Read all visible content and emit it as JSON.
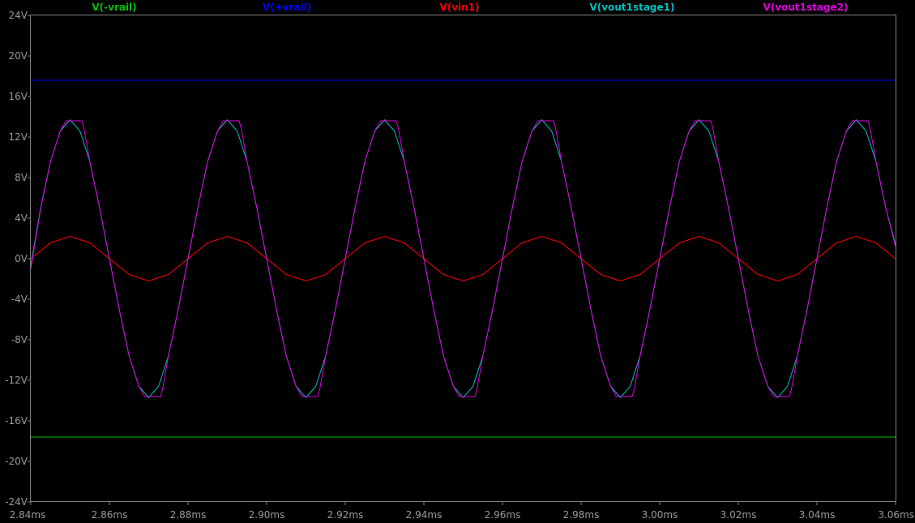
{
  "chart_data": {
    "type": "line",
    "title": "",
    "xlabel": "",
    "ylabel": "",
    "xlim": [
      2.84,
      3.06
    ],
    "ylim": [
      -24,
      24
    ],
    "grid": false,
    "legend_position": "top",
    "x_ticks": [
      2.84,
      2.86,
      2.88,
      2.9,
      2.92,
      2.94,
      2.96,
      2.98,
      3.0,
      3.02,
      3.04,
      3.06
    ],
    "x_tick_labels": [
      "2.84ms",
      "2.86ms",
      "2.88ms",
      "2.90ms",
      "2.92ms",
      "2.94ms",
      "2.96ms",
      "2.98ms",
      "3.00ms",
      "3.02ms",
      "3.04ms",
      "3.06ms"
    ],
    "y_ticks": [
      24,
      20,
      16,
      12,
      8,
      4,
      0,
      -4,
      -8,
      -12,
      -16,
      -20,
      -24
    ],
    "y_tick_labels": [
      "24V",
      "20V",
      "16V",
      "12V",
      "8V",
      "4V",
      "0V",
      "-4V",
      "-8V",
      "-12V",
      "-16V",
      "-20V",
      "-24V"
    ],
    "series": [
      {
        "name": "V(-vrail)",
        "color": "#00c000",
        "x": [
          2.84,
          3.06
        ],
        "values": [
          -17.6,
          -17.6
        ]
      },
      {
        "name": "V(+vrail)",
        "color": "#0000ff",
        "x": [
          2.84,
          3.06
        ],
        "values": [
          17.6,
          17.6
        ]
      },
      {
        "name": "V(vin1)",
        "color": "#ff0000",
        "x": [
          2.84,
          2.845,
          2.85,
          2.855,
          2.86,
          2.865,
          2.87,
          2.875,
          2.88,
          2.885,
          2.89,
          2.895,
          2.9,
          2.905,
          2.91,
          2.915,
          2.92,
          2.925,
          2.93,
          2.935,
          2.94,
          2.945,
          2.95,
          2.955,
          2.96,
          2.965,
          2.97,
          2.975,
          2.98,
          2.985,
          2.99,
          2.995,
          3.0,
          3.005,
          3.01,
          3.015,
          3.02,
          3.025,
          3.03,
          3.035,
          3.04,
          3.045,
          3.05,
          3.055,
          3.06
        ],
        "values": [
          0.0,
          1.56,
          2.2,
          1.56,
          0.0,
          -1.56,
          -2.2,
          -1.56,
          0.0,
          1.56,
          2.2,
          1.56,
          0.0,
          -1.56,
          -2.2,
          -1.56,
          0.0,
          1.56,
          2.2,
          1.56,
          0.0,
          -1.56,
          -2.2,
          -1.56,
          0.0,
          1.56,
          2.2,
          1.56,
          0.0,
          -1.56,
          -2.2,
          -1.56,
          0.0,
          1.56,
          2.2,
          1.56,
          0.0,
          -1.56,
          -2.2,
          -1.56,
          0.0,
          1.56,
          2.2,
          1.56,
          0.0
        ]
      },
      {
        "name": "V(vout1stage1)",
        "color": "#00c0c0",
        "x": [
          2.84,
          2.8425,
          2.845,
          2.8475,
          2.85,
          2.8525,
          2.855,
          2.8575,
          2.86,
          2.8625,
          2.865,
          2.8675,
          2.87,
          2.8725,
          2.875,
          2.8775,
          2.88,
          2.8825,
          2.885,
          2.8875,
          2.89,
          2.8925,
          2.895,
          2.8975,
          2.9,
          2.9025,
          2.905,
          2.9075,
          2.91,
          2.9125,
          2.915,
          2.9175,
          2.92,
          2.9225,
          2.925,
          2.9275,
          2.93,
          2.9325,
          2.935,
          2.9375,
          2.94,
          2.9425,
          2.945,
          2.9475,
          2.95,
          2.9525,
          2.955,
          2.9575,
          2.96,
          2.9625,
          2.965,
          2.9675,
          2.97,
          2.9725,
          2.975,
          2.9775,
          2.98,
          2.9825,
          2.985,
          2.9875,
          2.99,
          2.9925,
          2.995,
          2.9975,
          3.0,
          3.0025,
          3.005,
          3.0075,
          3.01,
          3.0125,
          3.015,
          3.0175,
          3.02,
          3.0225,
          3.025,
          3.0275,
          3.03,
          3.0325,
          3.035,
          3.0375,
          3.04,
          3.0425,
          3.045,
          3.0475,
          3.05,
          3.0525,
          3.055,
          3.0575,
          3.06
        ],
        "values": [
          -0.7,
          5.0,
          9.6,
          12.6,
          13.7,
          12.6,
          9.6,
          5.0,
          0.0,
          -5.0,
          -9.6,
          -12.6,
          -13.7,
          -12.6,
          -9.6,
          -5.0,
          0.0,
          5.0,
          9.6,
          12.6,
          13.7,
          12.6,
          9.6,
          5.0,
          0.0,
          -5.0,
          -9.6,
          -12.6,
          -13.7,
          -12.6,
          -9.6,
          -5.0,
          0.0,
          5.0,
          9.6,
          12.6,
          13.7,
          12.6,
          9.6,
          5.0,
          0.0,
          -5.0,
          -9.6,
          -12.6,
          -13.7,
          -12.6,
          -9.6,
          -5.0,
          0.0,
          5.0,
          9.6,
          12.6,
          13.7,
          12.6,
          9.6,
          5.0,
          0.0,
          -5.0,
          -9.6,
          -12.6,
          -13.7,
          -12.6,
          -9.6,
          -5.0,
          0.0,
          5.0,
          9.6,
          12.6,
          13.7,
          12.6,
          9.6,
          5.0,
          0.0,
          -5.0,
          -9.6,
          -12.6,
          -13.7,
          -12.6,
          -9.6,
          -5.0,
          0.0,
          5.0,
          9.6,
          12.6,
          13.7,
          12.6,
          9.6,
          5.0,
          1.4
        ]
      },
      {
        "name": "V(vout1stage2)",
        "color": "#e000e0",
        "x": [
          2.84,
          2.8425,
          2.845,
          2.8475,
          2.849,
          2.851,
          2.853,
          2.8535,
          2.855,
          2.8575,
          2.86,
          2.8625,
          2.865,
          2.8675,
          2.869,
          2.871,
          2.873,
          2.8735,
          2.875,
          2.8775,
          2.88,
          2.8825,
          2.885,
          2.8875,
          2.889,
          2.891,
          2.893,
          2.8935,
          2.895,
          2.8975,
          2.9,
          2.9025,
          2.905,
          2.9075,
          2.909,
          2.911,
          2.913,
          2.9135,
          2.915,
          2.9175,
          2.92,
          2.9225,
          2.925,
          2.9275,
          2.929,
          2.931,
          2.933,
          2.9335,
          2.935,
          2.9375,
          2.94,
          2.9425,
          2.945,
          2.9475,
          2.949,
          2.951,
          2.953,
          2.9535,
          2.955,
          2.9575,
          2.96,
          2.9625,
          2.965,
          2.9675,
          2.969,
          2.971,
          2.973,
          2.9735,
          2.975,
          2.9775,
          2.98,
          2.9825,
          2.985,
          2.9875,
          2.989,
          2.991,
          2.993,
          2.9935,
          2.995,
          2.9975,
          3.0,
          3.0025,
          3.005,
          3.0075,
          3.009,
          3.011,
          3.013,
          3.0135,
          3.015,
          3.0175,
          3.02,
          3.0225,
          3.025,
          3.0275,
          3.029,
          3.031,
          3.033,
          3.0335,
          3.035,
          3.0375,
          3.04,
          3.0425,
          3.045,
          3.0475,
          3.049,
          3.051,
          3.053,
          3.0535,
          3.055,
          3.0575,
          3.06
        ],
        "values": [
          -1.0,
          4.9,
          9.6,
          12.6,
          13.6,
          13.6,
          13.6,
          12.9,
          9.6,
          5.0,
          0.0,
          -5.0,
          -9.6,
          -12.6,
          -13.6,
          -13.6,
          -13.6,
          -12.9,
          -9.6,
          -5.0,
          0.0,
          5.0,
          9.6,
          12.6,
          13.6,
          13.6,
          13.6,
          12.9,
          9.6,
          5.0,
          0.0,
          -5.0,
          -9.6,
          -12.6,
          -13.6,
          -13.6,
          -13.6,
          -12.9,
          -9.6,
          -5.0,
          0.0,
          5.0,
          9.6,
          12.6,
          13.6,
          13.6,
          13.6,
          12.9,
          9.6,
          5.0,
          0.0,
          -5.0,
          -9.6,
          -12.6,
          -13.6,
          -13.6,
          -13.6,
          -12.9,
          -9.6,
          -5.0,
          0.0,
          5.0,
          9.6,
          12.6,
          13.6,
          13.6,
          13.6,
          12.9,
          9.6,
          5.0,
          0.0,
          -5.0,
          -9.6,
          -12.6,
          -13.6,
          -13.6,
          -13.6,
          -12.9,
          -9.6,
          -5.0,
          0.0,
          5.0,
          9.6,
          12.6,
          13.6,
          13.6,
          13.6,
          12.9,
          9.6,
          5.0,
          0.0,
          -5.0,
          -9.6,
          -12.6,
          -13.6,
          -13.6,
          -13.6,
          -12.9,
          -9.6,
          -5.0,
          0.0,
          5.0,
          9.6,
          12.6,
          13.6,
          13.6,
          13.6,
          12.9,
          9.6,
          5.0,
          1.2
        ]
      }
    ]
  }
}
